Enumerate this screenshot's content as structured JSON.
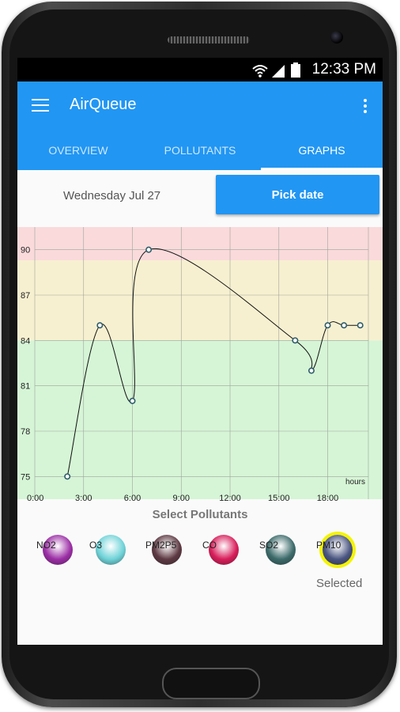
{
  "status": {
    "time": "12:33 PM"
  },
  "app": {
    "title": "AirQueue"
  },
  "tabs": [
    {
      "label": "OVERVIEW"
    },
    {
      "label": "POLLUTANTS"
    },
    {
      "label": "GRAPHS"
    }
  ],
  "date_row": {
    "date": "Wednesday Jul 27",
    "pick_label": "Pick date"
  },
  "chart_data": {
    "type": "line",
    "xlabel": "hours",
    "xlim": [
      0,
      20.5
    ],
    "ylim": [
      73.5,
      91.5
    ],
    "x_ticks": [
      {
        "v": 0,
        "label": "0:00"
      },
      {
        "v": 3,
        "label": "3:00"
      },
      {
        "v": 6,
        "label": "6:00"
      },
      {
        "v": 9,
        "label": "9:00"
      },
      {
        "v": 12,
        "label": "12:00"
      },
      {
        "v": 15,
        "label": "15:00"
      },
      {
        "v": 18,
        "label": "18:00"
      }
    ],
    "y_ticks": [
      75,
      78,
      81,
      84,
      87,
      90
    ],
    "grid": true,
    "bands": [
      {
        "from": 73.5,
        "to": 84.0,
        "color": "#d6f5d6"
      },
      {
        "from": 84.0,
        "to": 89.3,
        "color": "#f7f0d0"
      },
      {
        "from": 89.3,
        "to": 91.5,
        "color": "#fadadb"
      }
    ],
    "points": [
      {
        "x": 2,
        "y": 75
      },
      {
        "x": 4,
        "y": 85
      },
      {
        "x": 6,
        "y": 80
      },
      {
        "x": 7,
        "y": 90
      },
      {
        "x": 16,
        "y": 84
      },
      {
        "x": 17,
        "y": 82
      },
      {
        "x": 18,
        "y": 85
      },
      {
        "x": 19,
        "y": 85
      },
      {
        "x": 20,
        "y": 85
      }
    ]
  },
  "pollutants_panel": {
    "title": "Select Pollutants",
    "selected_label": "Selected",
    "items": [
      {
        "label": "NO2",
        "color": "#9c2fa6"
      },
      {
        "label": "O3",
        "color": "#6fd3d8"
      },
      {
        "label": "PM2P5",
        "color": "#5e3a43"
      },
      {
        "label": "CO",
        "color": "#d81e5b"
      },
      {
        "label": "SO2",
        "color": "#3d6b6b"
      },
      {
        "label": "PM10",
        "color": "#4a5580",
        "selected": true
      }
    ]
  }
}
